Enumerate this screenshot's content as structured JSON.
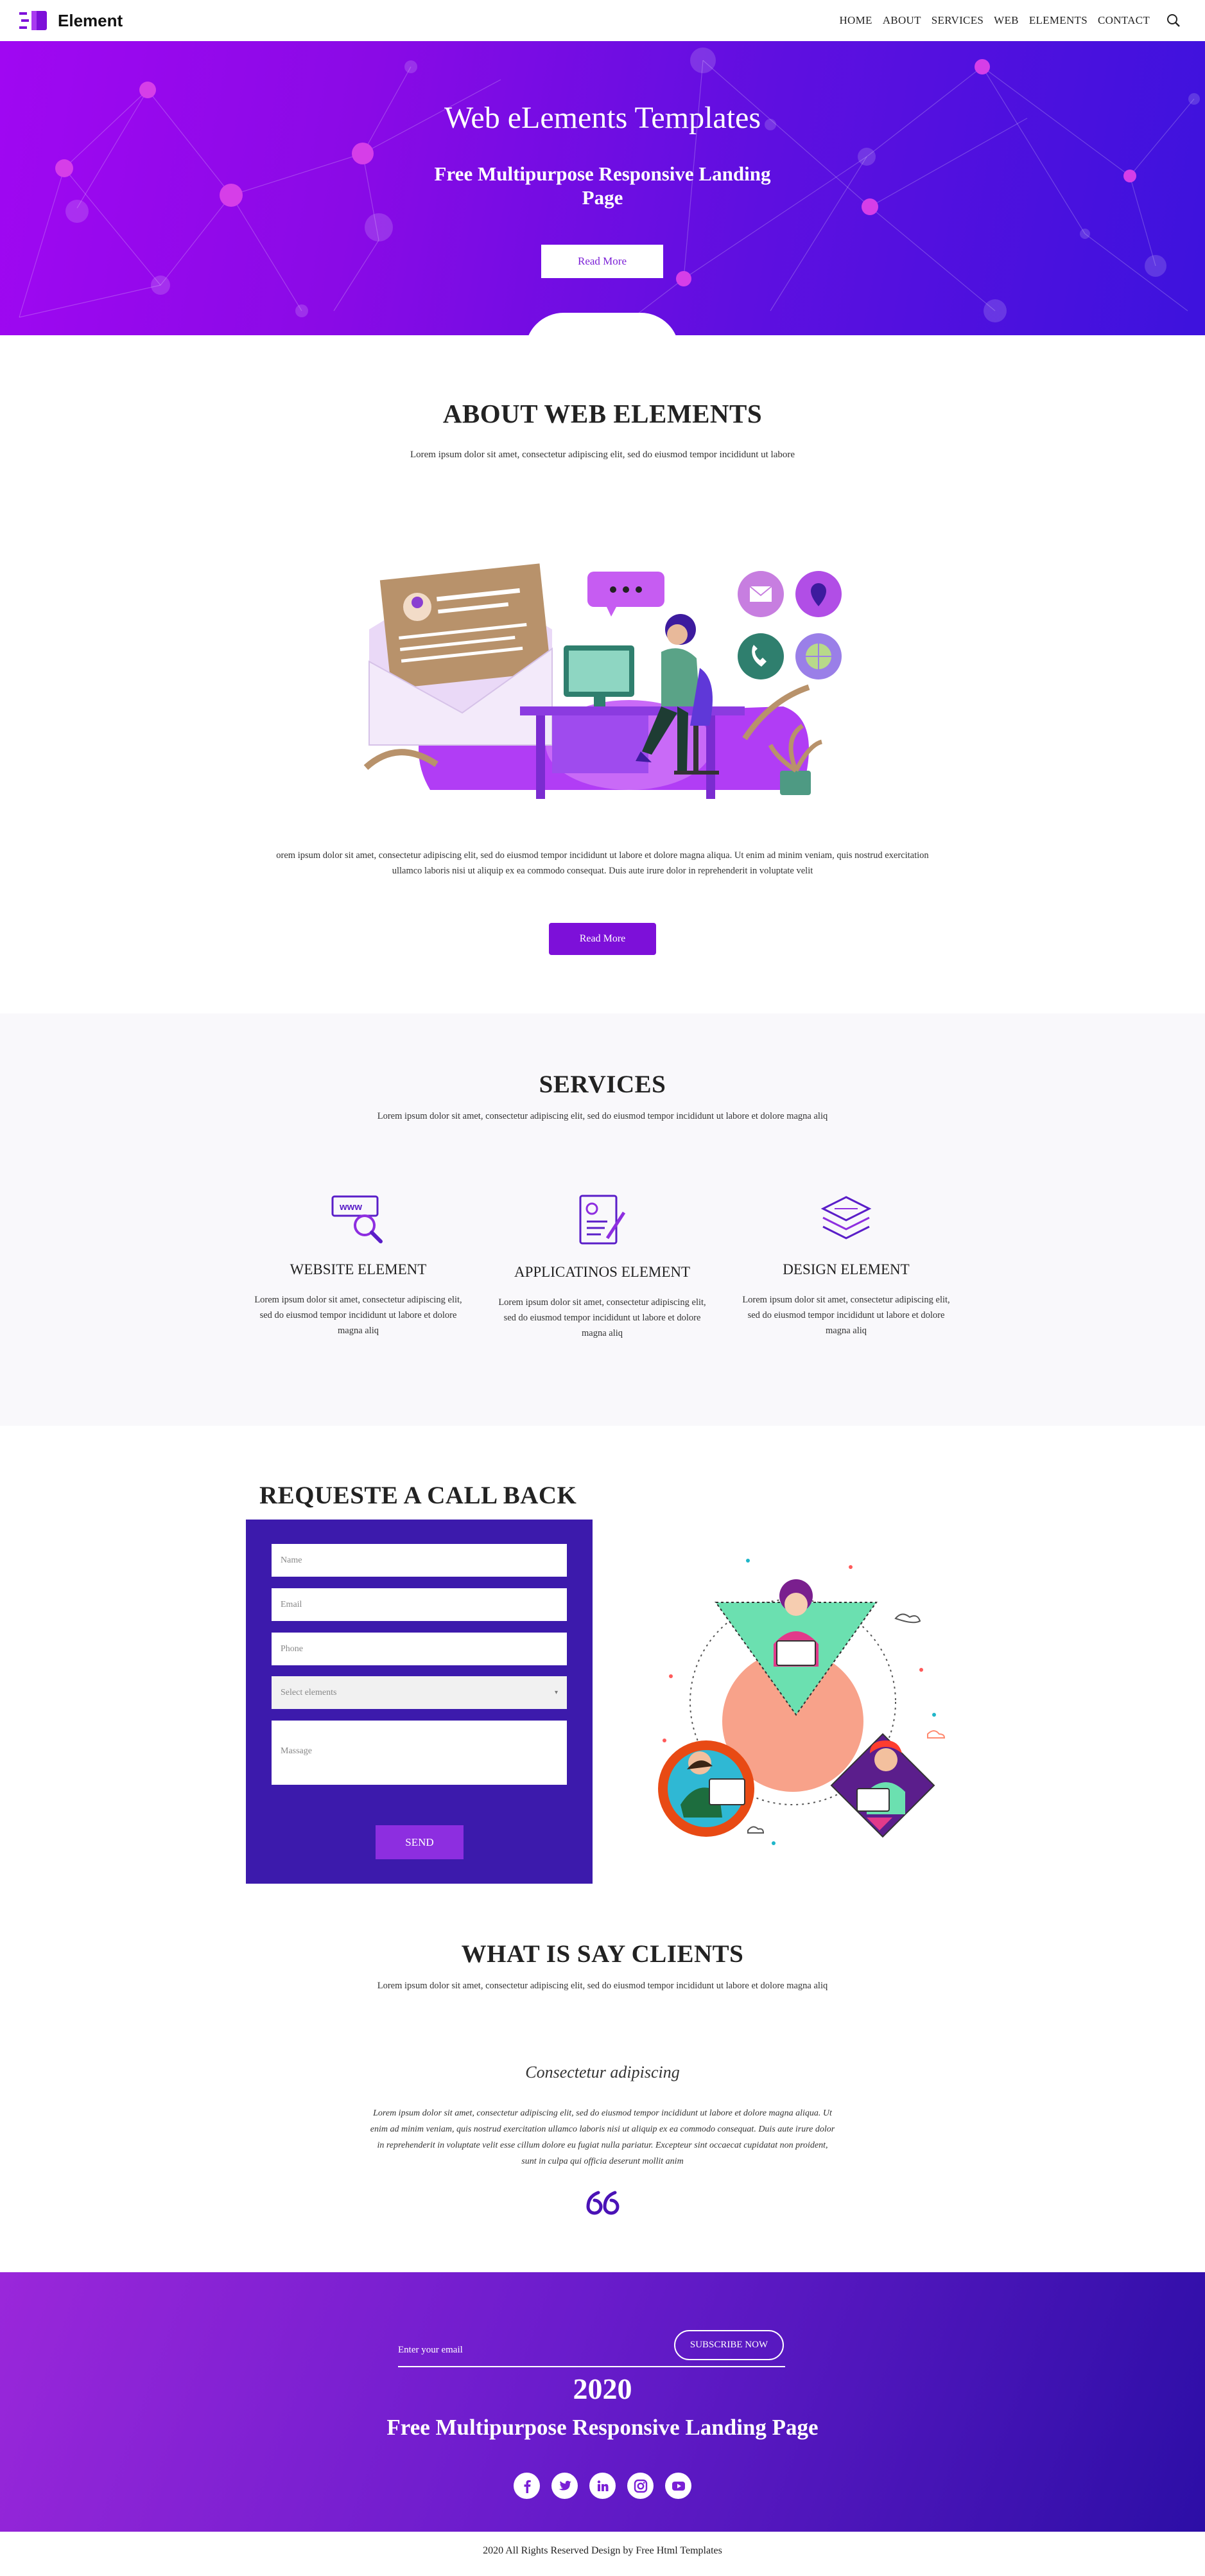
{
  "nav": {
    "brand": "Element",
    "items": [
      "HOME",
      "ABOUT",
      "SERVICES",
      "WEB",
      "ELEMENTS",
      "CONTACT"
    ]
  },
  "hero": {
    "title": "Web eLements Templates",
    "subtitle": "Free Multipurpose Responsive Landing Page",
    "button": "Read More"
  },
  "about": {
    "title": "ABOUT WEB ELEMENTS",
    "subtitle": "Lorem ipsum dolor sit amet, consectetur adipiscing elit, sed do eiusmod tempor incididunt ut labore",
    "paragraph": "orem ipsum dolor sit amet, consectetur adipiscing elit, sed do eiusmod tempor incididunt ut labore et dolore magna aliqua. Ut enim ad minim veniam, quis nostrud exercitation ullamco laboris nisi ut aliquip ex ea commodo consequat. Duis aute irure dolor in reprehenderit in voluptate velit",
    "button": "Read More"
  },
  "services": {
    "title": "SERVICES",
    "subtitle": "Lorem ipsum dolor sit amet, consectetur adipiscing elit, sed do eiusmod tempor incididunt ut labore et dolore magna aliq",
    "cards": [
      {
        "icon": "www-search-icon",
        "name": "WEBSITE ELEMENT",
        "desc": "Lorem ipsum dolor sit amet, consectetur adipiscing elit, sed do eiusmod tempor incididunt ut labore et dolore magna aliq"
      },
      {
        "icon": "document-profile-icon",
        "name": "APPLICATINOS ELEMENT",
        "desc": "Lorem ipsum dolor sit amet, consectetur adipiscing elit, sed do eiusmod tempor incididunt ut labore et dolore magna aliq"
      },
      {
        "icon": "layers-icon",
        "name": "DESIGN ELEMENT",
        "desc": "Lorem ipsum dolor sit amet, consectetur adipiscing elit, sed do eiusmod tempor incididunt ut labore et dolore magna aliq"
      }
    ]
  },
  "callback": {
    "title": "REQUESTE A CALL BACK",
    "name_placeholder": "Name",
    "email_placeholder": "Email",
    "phone_placeholder": "Phone",
    "select_value": "Select elements",
    "message_placeholder": "Massage",
    "send": "SEND"
  },
  "clients": {
    "title": "WHAT IS SAY CLIENTS",
    "subtitle": "Lorem ipsum dolor sit amet, consectetur adipiscing elit, sed do eiusmod tempor incididunt ut labore et dolore magna aliq",
    "name": "Consectetur adipiscing",
    "quote": "Lorem ipsum dolor sit amet, consectetur adipiscing elit, sed do eiusmod tempor incididunt ut labore et dolore magna aliqua. Ut enim ad minim veniam, quis nostrud exercitation ullamco laboris nisi ut aliquip ex ea commodo consequat. Duis aute irure dolor in reprehenderit in voluptate velit esse cillum dolore eu fugiat nulla pariatur. Excepteur sint occaecat cupidatat non proident, sunt in culpa qui officia deserunt mollit anim"
  },
  "footer": {
    "email_placeholder": "Enter your email",
    "subscribe": "SUBSCRIBE NOW",
    "year": "2020",
    "tagline": "Free Multipurpose Responsive Landing Page",
    "socials": [
      "facebook-icon",
      "twitter-icon",
      "linkedin-icon",
      "instagram-icon",
      "youtube-icon"
    ],
    "copyright": "2020 All Rights Reserved Design by Free Html Templates"
  },
  "colors": {
    "brand_purple": "#7d10d9",
    "form_bg": "#3c1aac",
    "hero_start": "#a007f2",
    "hero_end": "#3d12dd"
  }
}
